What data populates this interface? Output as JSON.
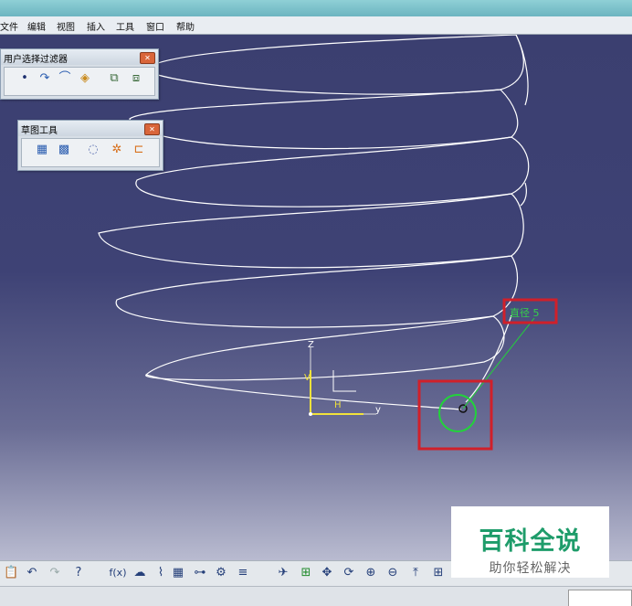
{
  "menu": {
    "items": [
      {
        "label": "文件"
      },
      {
        "label": "编辑"
      },
      {
        "label": "视图"
      },
      {
        "label": "插入"
      },
      {
        "label": "工具"
      },
      {
        "label": "窗口"
      },
      {
        "label": "帮助"
      }
    ]
  },
  "toolbars": {
    "user_filter": {
      "title": "用户选择过滤器",
      "icons": [
        "point-filter-icon",
        "curve-filter-icon",
        "surface-filter-icon",
        "volume-filter-icon",
        "feature-filter-icon",
        "geometry-filter-icon"
      ]
    },
    "sketch_tools": {
      "title": "草图工具",
      "icons": [
        "grid-icon",
        "snap-to-point-icon",
        "construction-element-icon",
        "geometric-constraints-icon",
        "dimensional-constraints-icon"
      ]
    }
  },
  "viewport": {
    "dimension_label": "直径 5",
    "axes": {
      "z": "Z",
      "y": "y",
      "h": "H",
      "v": "V"
    },
    "colors": {
      "background_top": "#3b3f70",
      "curve": "#ffffff",
      "circle": "#22d33a",
      "highlight_box": "#d0202a",
      "axis_yellow": "#f1e23a"
    }
  },
  "bottom_toolbar": {
    "formula_label": "f(x)",
    "icons": [
      "paste-icon",
      "undo-icon",
      "redo-icon",
      "help-icon",
      "formula-icon",
      "comment-icon",
      "measure-icon",
      "table-icon",
      "tree-icon",
      "part-icon",
      "catalog-icon",
      "fly-mode-icon",
      "fit-all-icon",
      "pan-icon",
      "rotate-icon",
      "zoom-in-icon",
      "zoom-out-icon",
      "normal-view-icon",
      "multi-view-icon"
    ]
  },
  "watermark": {
    "main": "百科全说",
    "sub": "助你轻松解决"
  }
}
